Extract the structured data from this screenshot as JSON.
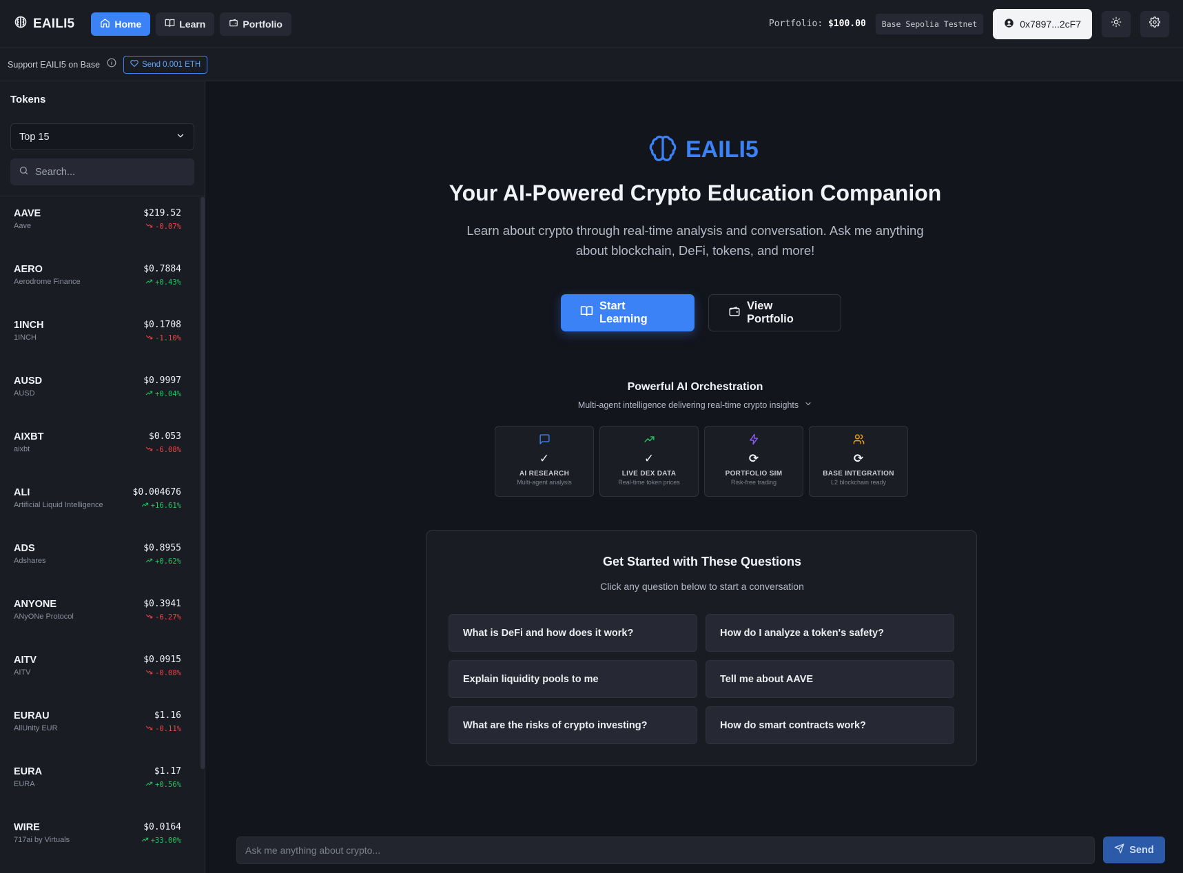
{
  "header": {
    "brand": "EAILI5",
    "nav": [
      {
        "label": "Home",
        "icon": "home-icon",
        "active": true
      },
      {
        "label": "Learn",
        "icon": "book-icon",
        "active": false
      },
      {
        "label": "Portfolio",
        "icon": "wallet-icon",
        "active": false
      }
    ],
    "portfolio_label": "Portfolio:",
    "portfolio_value": "$100.00",
    "network": "Base Sepolia Testnet",
    "wallet": "0x7897...2cF7"
  },
  "support": {
    "text": "Support EAILI5 on Base",
    "button": "Send 0.001 ETH"
  },
  "sidebar": {
    "title": "Tokens",
    "filter_selected": "Top 15",
    "search_placeholder": "Search...",
    "tokens": [
      {
        "symbol": "AAVE",
        "name": "Aave",
        "price": "$219.52",
        "change": "-0.07%",
        "direction": "down"
      },
      {
        "symbol": "AERO",
        "name": "Aerodrome Finance",
        "price": "$0.7884",
        "change": "+0.43%",
        "direction": "up"
      },
      {
        "symbol": "1INCH",
        "name": "1INCH",
        "price": "$0.1708",
        "change": "-1.10%",
        "direction": "down"
      },
      {
        "symbol": "AUSD",
        "name": "AUSD",
        "price": "$0.9997",
        "change": "+0.04%",
        "direction": "up"
      },
      {
        "symbol": "AIXBT",
        "name": "aixbt",
        "price": "$0.053",
        "change": "-6.08%",
        "direction": "down"
      },
      {
        "symbol": "ALI",
        "name": "Artificial Liquid Intelligence",
        "price": "$0.004676",
        "change": "+16.61%",
        "direction": "up"
      },
      {
        "symbol": "ADS",
        "name": "Adshares",
        "price": "$0.8955",
        "change": "+0.62%",
        "direction": "up"
      },
      {
        "symbol": "ANYONE",
        "name": "ANyONe Protocol",
        "price": "$0.3941",
        "change": "-6.27%",
        "direction": "down"
      },
      {
        "symbol": "AITV",
        "name": "AITV",
        "price": "$0.0915",
        "change": "-0.08%",
        "direction": "down"
      },
      {
        "symbol": "EURAU",
        "name": "AllUnity EUR",
        "price": "$1.16",
        "change": "-0.11%",
        "direction": "down"
      },
      {
        "symbol": "EURA",
        "name": "EURA",
        "price": "$1.17",
        "change": "+0.56%",
        "direction": "up"
      },
      {
        "symbol": "WIRE",
        "name": "717ai by Virtuals",
        "price": "$0.0164",
        "change": "+33.00%",
        "direction": "up"
      }
    ]
  },
  "hero": {
    "brand": "EAILI5",
    "title": "Your AI-Powered Crypto Education Companion",
    "subtitle": "Learn about crypto through real-time analysis and conversation. Ask me anything about blockchain, DeFi, tokens, and more!",
    "primary_cta": "Start Learning",
    "secondary_cta": "View Portfolio"
  },
  "orchestration": {
    "title": "Powerful AI Orchestration",
    "subtitle": "Multi-agent intelligence delivering real-time crypto insights",
    "features": [
      {
        "icon": "chat-bubble-icon",
        "color": "#3b82f6",
        "status": "✓",
        "name": "AI RESEARCH",
        "desc": "Multi-agent analysis"
      },
      {
        "icon": "trending-up-icon",
        "color": "#22c55e",
        "status": "✓",
        "name": "LIVE DEX DATA",
        "desc": "Real-time token prices"
      },
      {
        "icon": "lightning-icon",
        "color": "#8b5cf6",
        "status": "⟳",
        "name": "PORTFOLIO SIM",
        "desc": "Risk-free trading"
      },
      {
        "icon": "users-icon",
        "color": "#f59e0b",
        "status": "⟳",
        "name": "BASE INTEGRATION",
        "desc": "L2 blockchain ready"
      }
    ]
  },
  "questions": {
    "title": "Get Started with These Questions",
    "subtitle": "Click any question below to start a conversation",
    "items": [
      "What is DeFi and how does it work?",
      "How do I analyze a token's safety?",
      "Explain liquidity pools to me",
      "Tell me about AAVE",
      "What are the risks of crypto investing?",
      "How do smart contracts work?"
    ]
  },
  "chat": {
    "placeholder": "Ask me anything about crypto...",
    "send": "Send"
  }
}
